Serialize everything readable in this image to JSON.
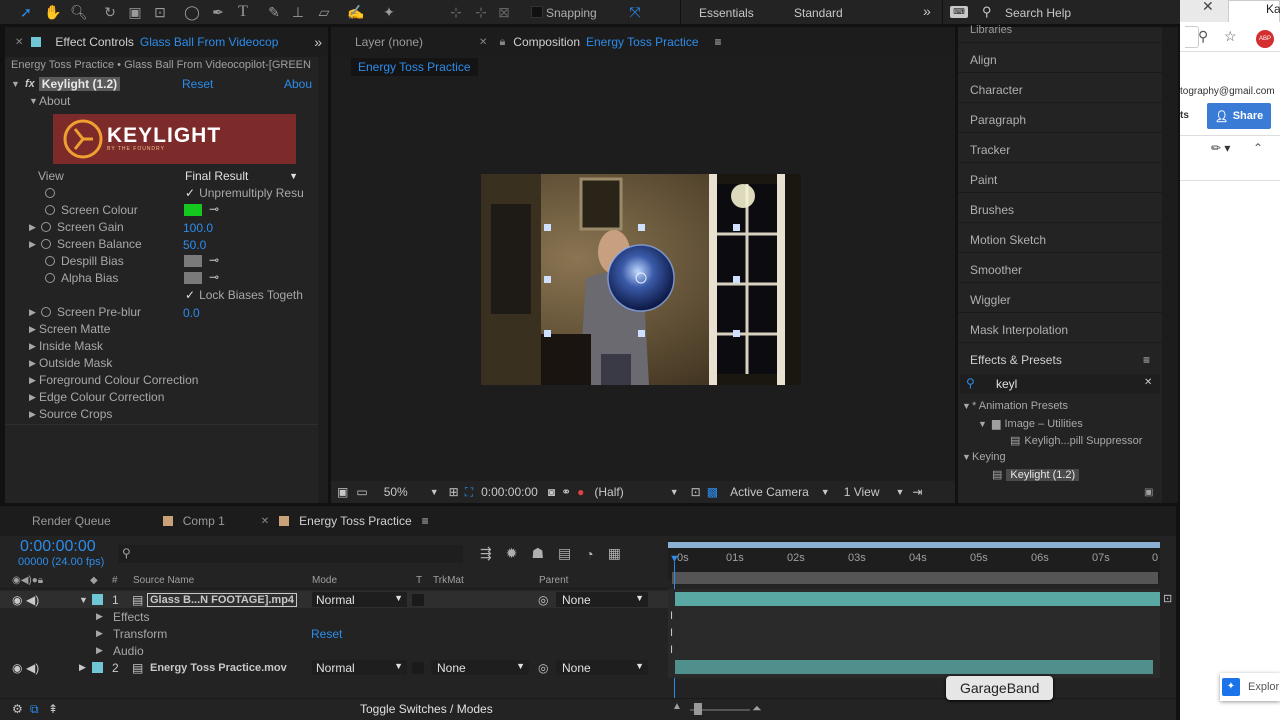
{
  "toolbar": {
    "snapping": "Snapping",
    "workspaces": [
      "Essentials",
      "Standard"
    ],
    "search_help": "Search Help"
  },
  "effect_controls": {
    "tab_label": "Effect Controls",
    "tab_layer": "Glass Ball From Videocop",
    "breadcrumb": "Energy Toss Practice • Glass Ball From Videocopilot-[GREEN",
    "effect_name": "Keylight (1.2)",
    "reset": "Reset",
    "about_link": "Abou",
    "about_label": "About",
    "logo_text": "KEYLIGHT",
    "logo_sub": "BY THE FOUNDRY",
    "view_label": "View",
    "view_value": "Final Result",
    "unpremultiply": "Unpremultiply Resu",
    "screen_colour": "Screen Colour",
    "screen_gain": "Screen Gain",
    "screen_gain_value": "100.0",
    "screen_balance": "Screen Balance",
    "screen_balance_value": "50.0",
    "despill_bias": "Despill Bias",
    "alpha_bias": "Alpha Bias",
    "lock_biases": "Lock Biases Togeth",
    "screen_preblur": "Screen Pre-blur",
    "screen_preblur_value": "0.0",
    "groups": [
      "Screen Matte",
      "Inside Mask",
      "Outside Mask",
      "Foreground Colour Correction",
      "Edge Colour Correction",
      "Source Crops"
    ],
    "colors": {
      "screen": "#14c81e",
      "despill": "#7a7a7a",
      "alpha": "#7a7a7a"
    }
  },
  "composition": {
    "layer_tab": "Layer (none)",
    "comp_tab_prefix": "Composition",
    "comp_tab_name": "Energy Toss Practice",
    "comp_chip": "Energy Toss Practice",
    "zoom": "50%",
    "timecode": "0:00:00:00",
    "resolution": "(Half)",
    "camera": "Active Camera",
    "views": "1 View"
  },
  "right_panel": {
    "items": [
      "Libraries",
      "Align",
      "Character",
      "Paragraph",
      "Tracker",
      "Paint",
      "Brushes",
      "Motion Sketch",
      "Smoother",
      "Wiggler",
      "Mask Interpolation"
    ],
    "effects_presets": "Effects & Presets",
    "search_value": "keyl",
    "tree": {
      "animation_presets": "* Animation Presets",
      "image_utilities": "Image – Utilities",
      "keylight_preset": "Keyligh...pill Suppressor",
      "keying": "Keying",
      "keylight": "Keylight (1.2)"
    }
  },
  "timeline": {
    "tabs": [
      "Render Queue",
      "Comp 1",
      "Energy Toss Practice"
    ],
    "timecode": "0:00:00:00",
    "fps": "00000 (24.00 fps)",
    "headers": {
      "num": "#",
      "source": "Source Name",
      "mode": "Mode",
      "t": "T",
      "trkmat": "TrkMat",
      "parent": "Parent"
    },
    "ruler": [
      "0s",
      "01s",
      "02s",
      "03s",
      "04s",
      "05s",
      "06s",
      "07s",
      "0"
    ],
    "layers": [
      {
        "num": "1",
        "name": "Glass B...N FOOTAGE].mp4",
        "mode": "Normal",
        "trkmat": "",
        "parent": "None"
      },
      {
        "num": "2",
        "name": "Energy Toss Practice.mov",
        "mode": "Normal",
        "trkmat": "None",
        "parent": "None"
      }
    ],
    "sub_rows": [
      "Effects",
      "Transform",
      "Audio"
    ],
    "transform_reset": "Reset",
    "toggle": "Toggle Switches / Modes",
    "tooltip": "GarageBand"
  },
  "browser": {
    "email_fragment": "tography@gmail.com",
    "share": "Share",
    "ts_fragment": "ts",
    "explore": "Explor",
    "top_fragment": "Ka",
    "abp": "ABP"
  }
}
